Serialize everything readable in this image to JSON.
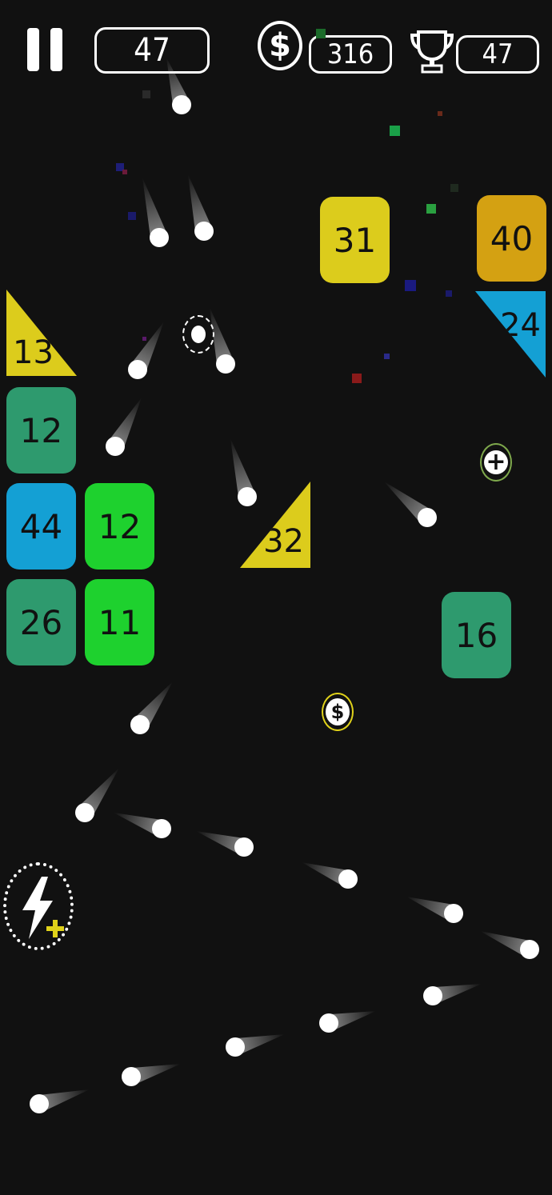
{
  "hud": {
    "level": "47",
    "coins_icon": "$",
    "coins": "316",
    "best": "47",
    "pause_icon": "pause-icon",
    "trophy_icon": "trophy-icon"
  },
  "blocks": {
    "b31": "31",
    "b40": "40",
    "b24": "24",
    "b13": "13",
    "b12a": "12",
    "b44": "44",
    "b12b": "12",
    "b32": "32",
    "b26": "26",
    "b11": "11",
    "b16": "16"
  },
  "pickups": {
    "coin_symbol": "$",
    "plus_symbol": "+"
  },
  "colors": {
    "yellow": "#dccc1c",
    "orange": "#d4a112",
    "blue": "#14a0d4",
    "teal": "#2e9a6e",
    "green": "#1ed12e",
    "background": "#111111"
  }
}
